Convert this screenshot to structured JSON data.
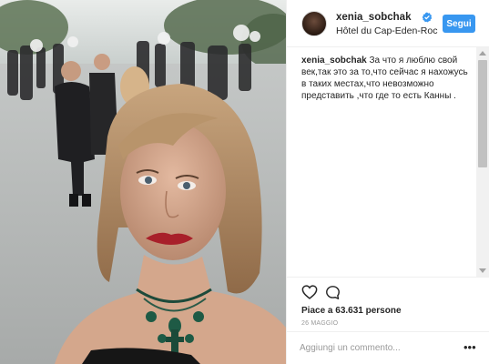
{
  "post": {
    "username": "xenia_sobchak",
    "location": "Hôtel du Cap-Eden-Roc",
    "follow_label": "Segui",
    "caption_text": "За что я люблю свой век,так это за то,что сейчас я нахожусь в таких местах,что невозможно представить ,что где то есть Канны ."
  },
  "actions": {
    "likes_text": "Piace a 63.631 persone",
    "date_text": "26 MAGGIO"
  },
  "comment_box": {
    "placeholder": "Aggiungi un commento..."
  },
  "icons": {
    "like": "heart-icon",
    "comment": "comment-bubble-icon",
    "verified": "verified-badge-icon",
    "more": "more-options-icon"
  },
  "colors": {
    "accent": "#3897f0",
    "text": "#262626",
    "muted": "#999999"
  }
}
